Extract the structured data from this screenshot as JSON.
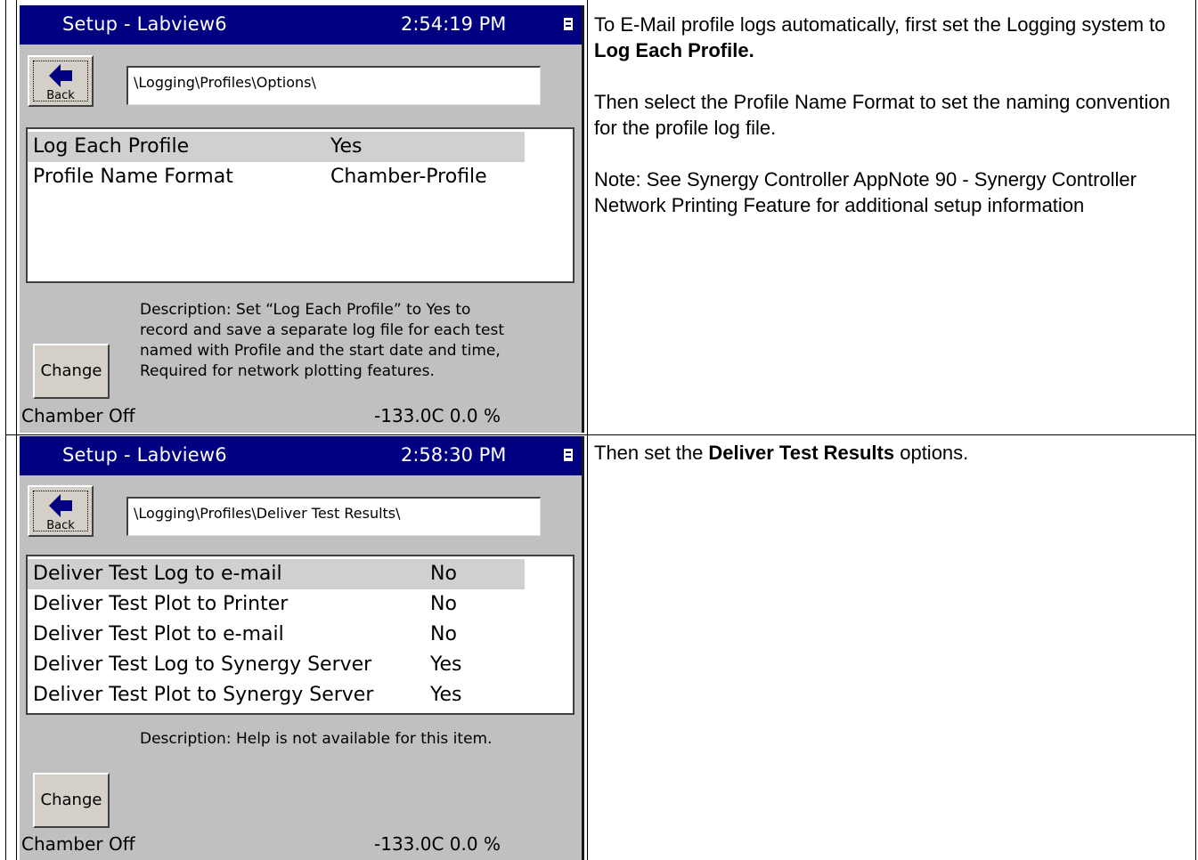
{
  "row1": {
    "screen": {
      "title": "Setup - Labview6",
      "time": "2:54:19 PM",
      "back_label": "Back",
      "path": "\\Logging\\Profiles\\Options\\",
      "items": [
        {
          "label": "Log Each Profile",
          "value": "Yes",
          "selected": true
        },
        {
          "label": "Profile Name Format",
          "value": "Chamber-Profile",
          "selected": false
        }
      ],
      "description_lines": [
        "Description:  Set “Log Each Profile” to Yes to",
        "record and save a separate log file for each test",
        "named with Profile and the start date and time,",
        "Required for network plotting features."
      ],
      "change_label": "Change",
      "status": "Chamber Off",
      "reading": "-133.0C  0.0 %"
    },
    "note": {
      "p1_before": "To E-Mail profile logs automatically, first set the Logging system to ",
      "p1_bold": "Log Each Profile.",
      "p2": "Then select the Profile Name Format to set the naming convention for the profile log file.",
      "p3": "Note: See Synergy Controller AppNote 90 - Synergy Controller Network Printing Feature for additional setup information"
    }
  },
  "row2": {
    "screen": {
      "title": "Setup - Labview6",
      "time": "2:58:30 PM",
      "back_label": "Back",
      "path": "\\Logging\\Profiles\\Deliver Test Results\\",
      "items": [
        {
          "label": "Deliver Test Log to e-mail",
          "value": "No",
          "selected": true
        },
        {
          "label": "Deliver Test Plot to Printer",
          "value": "No",
          "selected": false
        },
        {
          "label": "Deliver Test Plot to e-mail",
          "value": "No",
          "selected": false
        },
        {
          "label": "Deliver Test Log to Synergy Server",
          "value": "Yes",
          "selected": false
        },
        {
          "label": "Deliver Test Plot to Synergy Server",
          "value": "Yes",
          "selected": false
        }
      ],
      "description_lines": [
        "Description:  Help is not available for this item."
      ],
      "change_label": "Change",
      "status": "Chamber Off",
      "reading": "-133.0C  0.0 %"
    },
    "note": {
      "p1_before": "Then set the ",
      "p1_bold": "Deliver Test Results",
      "p1_after": " options."
    }
  },
  "colors": {
    "titlebar": "#000080",
    "screen_bg": "#c0c0c0",
    "selected_row": "#d0d0d0"
  },
  "icons": [
    "back-arrow-icon",
    "window-menu-icon"
  ]
}
